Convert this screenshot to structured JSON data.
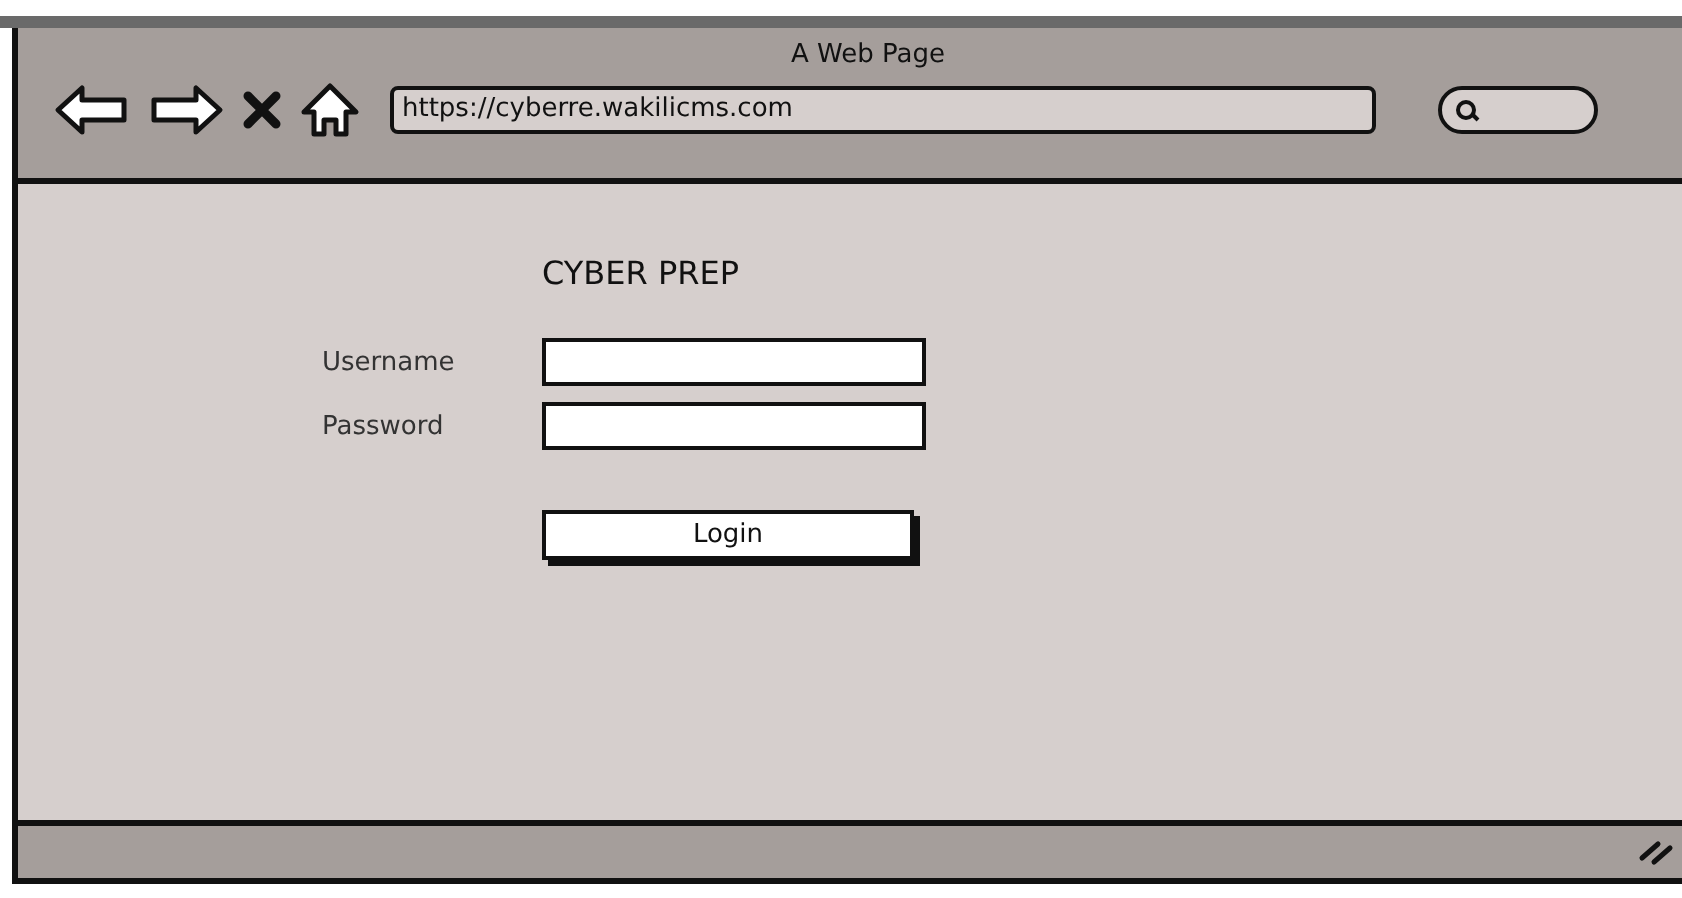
{
  "window": {
    "title": "A Web Page"
  },
  "address_bar": {
    "value": "https://cyberre.wakilicms.com"
  },
  "page": {
    "heading": "CYBER PREP",
    "fields": [
      {
        "label": "Username"
      },
      {
        "label": "Password"
      }
    ],
    "button": "Login"
  }
}
